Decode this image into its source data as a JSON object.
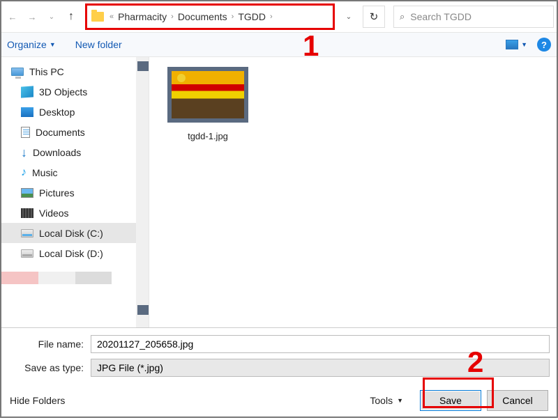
{
  "nav": {
    "crumb_prefix": "«",
    "crumbs": [
      "Pharmacity",
      "Documents",
      "TGDD"
    ]
  },
  "search": {
    "placeholder": "Search TGDD"
  },
  "toolbar": {
    "organize": "Organize",
    "new_folder": "New folder"
  },
  "tree": [
    {
      "icon": "pc",
      "label": "This PC",
      "indent": false
    },
    {
      "icon": "3d",
      "label": "3D Objects",
      "indent": true
    },
    {
      "icon": "desk",
      "label": "Desktop",
      "indent": true
    },
    {
      "icon": "doc",
      "label": "Documents",
      "indent": true
    },
    {
      "icon": "dl",
      "label": "Downloads",
      "indent": true
    },
    {
      "icon": "music",
      "label": "Music",
      "indent": true
    },
    {
      "icon": "pic",
      "label": "Pictures",
      "indent": true
    },
    {
      "icon": "vid",
      "label": "Videos",
      "indent": true
    },
    {
      "icon": "disk",
      "label": "Local Disk (C:)",
      "indent": true,
      "selected": true
    },
    {
      "icon": "diskd",
      "label": "Local Disk (D:)",
      "indent": true
    }
  ],
  "files": [
    {
      "name": "tgdd-1.jpg"
    }
  ],
  "form": {
    "filename_label": "File name:",
    "filename_value": "20201127_205658.jpg",
    "type_label": "Save as type:",
    "type_value": "JPG File (*.jpg)"
  },
  "footer": {
    "hide": "Hide Folders",
    "tools": "Tools",
    "save": "Save",
    "cancel": "Cancel"
  },
  "annotations": {
    "one": "1",
    "two": "2"
  }
}
